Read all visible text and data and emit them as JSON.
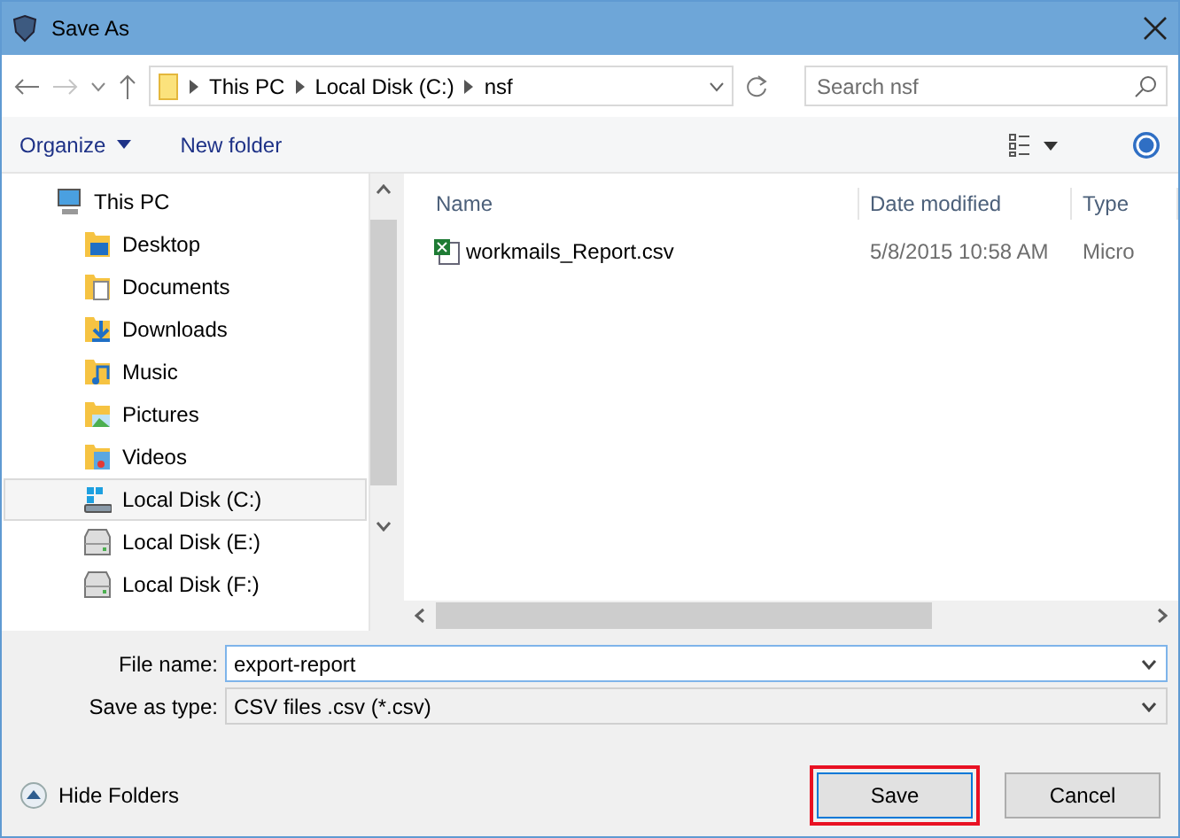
{
  "window": {
    "title": "Save As"
  },
  "address_bar": {
    "path": [
      "This PC",
      "Local Disk (C:)",
      "nsf"
    ]
  },
  "search": {
    "placeholder": "Search nsf"
  },
  "toolbar": {
    "organize": "Organize",
    "new_folder": "New folder"
  },
  "sidebar": {
    "items": [
      {
        "label": "This PC",
        "kind": "computer",
        "selected": false,
        "children": [
          {
            "label": "Desktop",
            "kind": "desktop",
            "selected": false
          },
          {
            "label": "Documents",
            "kind": "documents",
            "selected": false
          },
          {
            "label": "Downloads",
            "kind": "downloads",
            "selected": false
          },
          {
            "label": "Music",
            "kind": "music",
            "selected": false
          },
          {
            "label": "Pictures",
            "kind": "pictures",
            "selected": false
          },
          {
            "label": "Videos",
            "kind": "videos",
            "selected": false
          },
          {
            "label": "Local Disk (C:)",
            "kind": "system-drive",
            "selected": true
          },
          {
            "label": "Local Disk (E:)",
            "kind": "drive",
            "selected": false
          },
          {
            "label": "Local Disk (F:)",
            "kind": "drive",
            "selected": false
          }
        ]
      }
    ]
  },
  "file_list": {
    "columns": [
      "Name",
      "Date modified",
      "Type"
    ],
    "rows": [
      {
        "name": "workmails_Report.csv",
        "date": "5/8/2015 10:58 AM",
        "type": "Micro"
      }
    ]
  },
  "file_name": {
    "label": "File name:",
    "value": "export-report"
  },
  "save_as_type": {
    "label": "Save as type:",
    "value": "CSV files .csv (*.csv)"
  },
  "hide_folders": "Hide Folders",
  "buttons": [
    {
      "label": "Save",
      "kind": "primary",
      "highlighted": true
    },
    {
      "label": "Cancel",
      "kind": "secondary",
      "highlighted": false
    }
  ]
}
